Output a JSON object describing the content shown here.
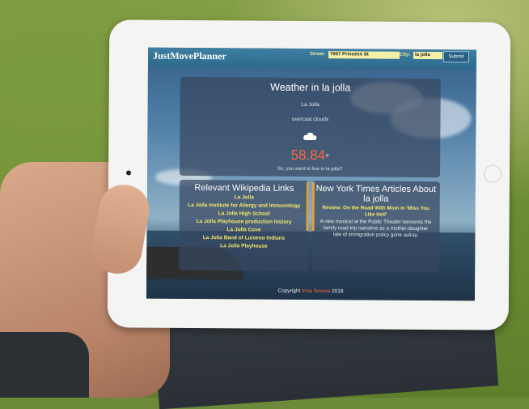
{
  "app": {
    "brand": "JustMovePlanner"
  },
  "search": {
    "street_label": "Street:",
    "street_value": "7957 Princess St",
    "city_label": "City:",
    "city_value": "la jolla",
    "submit_label": "Submit"
  },
  "weather": {
    "title": "Weather in la jolla",
    "city": "La Jolla",
    "description": "overcast clouds",
    "icon": "cloud-icon",
    "temperature": "58.84",
    "unit": "F",
    "question": "So, you want to live in la jolla?"
  },
  "wiki": {
    "title": "Relevant Wikipedia Links",
    "links": [
      "La Jolla",
      "La Jolla Institute for Allergy and Immunology",
      "La Jolla High School",
      "La Jolla Playhouse production history",
      "La Jolla Cove",
      "La Jolla Band of Luiseno Indians",
      "La Jolla Playhouse"
    ]
  },
  "nyt": {
    "title": "New York Times Articles About la jolla",
    "article_headline": "Review: On the Road With Mom in 'Miss You Like Hell'",
    "article_summary": "A new musical at the Public Theater reinvents the family road trip narrative as a mother-daughter tale of immigration policy gone astray."
  },
  "footer": {
    "copyright": "Copyright",
    "author": "Irina Serova",
    "year": "2018"
  },
  "colors": {
    "header": "#2d6a8d",
    "temperature": "#ff6a3a",
    "link": "#f7e96a"
  }
}
